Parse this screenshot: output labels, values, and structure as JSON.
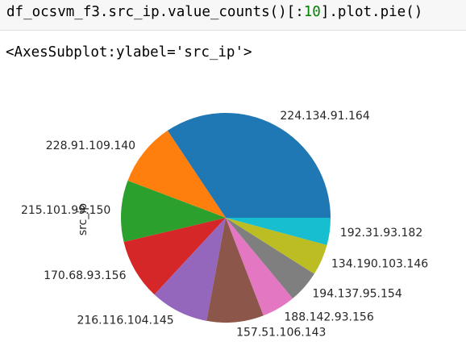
{
  "cell": {
    "code_prefix": "df_ocsvm_f3.src_ip.value_counts()[:",
    "code_number": "10",
    "code_suffix": "].plot.pie()"
  },
  "output": {
    "repr": "<AxesSubplot:ylabel='src_ip'>"
  },
  "chart_data": {
    "type": "pie",
    "ylabel": "src_ip",
    "start_angle_deg": 0,
    "direction": "counterclockwise",
    "slices": [
      {
        "label": "224.134.91.164",
        "value": 35.2,
        "color": "#1f77b4"
      },
      {
        "label": "228.91.109.140",
        "value": 10.1,
        "color": "#ff7f0e"
      },
      {
        "label": "215.101.99.150",
        "value": 9.7,
        "color": "#2ca02c"
      },
      {
        "label": "170.68.93.156",
        "value": 9.6,
        "color": "#d62728"
      },
      {
        "label": "216.116.104.145",
        "value": 9.2,
        "color": "#9467bd"
      },
      {
        "label": "157.51.106.143",
        "value": 9.0,
        "color": "#8c564b"
      },
      {
        "label": "188.142.93.156",
        "value": 5.3,
        "color": "#e377c2"
      },
      {
        "label": "194.137.95.154",
        "value": 5.1,
        "color": "#7f7f7f"
      },
      {
        "label": "134.190.103.146",
        "value": 4.9,
        "color": "#bcbd22"
      },
      {
        "label": "192.31.93.182",
        "value": 4.3,
        "color": "#17becf"
      }
    ]
  }
}
